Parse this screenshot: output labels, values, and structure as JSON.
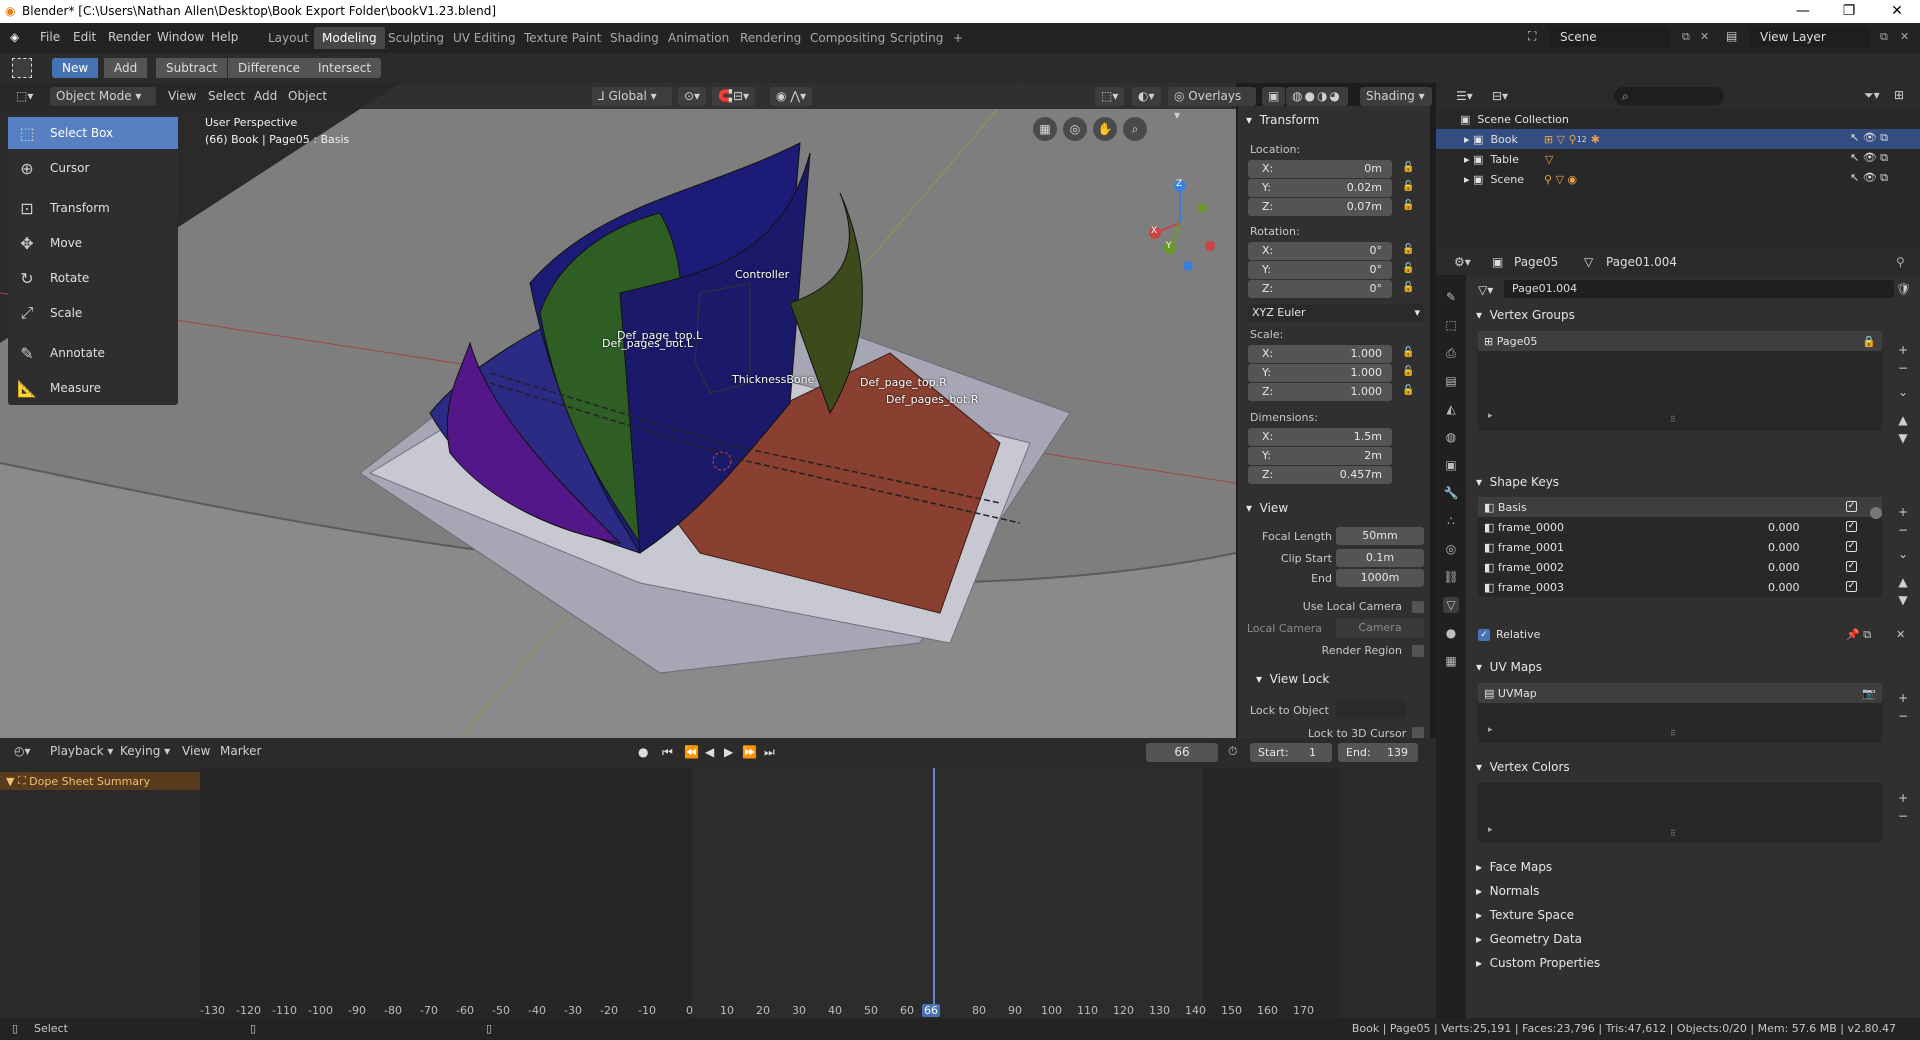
{
  "window": {
    "title": "Blender* [C:\\Users\\Nathan Allen\\Desktop\\Book Export Folder\\bookV1.23.blend]",
    "minimize": "—",
    "maximize": "❐",
    "close": "✕"
  },
  "menu": [
    "File",
    "Edit",
    "Render",
    "Window",
    "Help"
  ],
  "workspaces": [
    "Layout",
    "Modeling",
    "Sculpting",
    "UV Editing",
    "Texture Paint",
    "Shading",
    "Animation",
    "Rendering",
    "Compositing",
    "Scripting",
    "+"
  ],
  "scene": {
    "name": "Scene",
    "view_layer": "View Layer"
  },
  "toolheader": {
    "buttons": [
      "New",
      "Add",
      "Subtract",
      "Difference",
      "Intersect"
    ]
  },
  "viewport": {
    "mode": "Object Mode",
    "menus": [
      "View",
      "Select",
      "Add",
      "Object"
    ],
    "orientation": "Global",
    "overlays": "Overlays",
    "shading": "Shading",
    "perspective": "User Perspective",
    "object_info": "(66) Book | Page05 : Basis"
  },
  "tools": [
    {
      "label": "Select Box",
      "icon": "select-box"
    },
    {
      "label": "Cursor",
      "icon": "cursor"
    },
    {
      "label": "Transform",
      "icon": "transform"
    },
    {
      "label": "Move",
      "icon": "move"
    },
    {
      "label": "Rotate",
      "icon": "rotate"
    },
    {
      "label": "Scale",
      "icon": "scale"
    },
    {
      "label": "Annotate",
      "icon": "annotate"
    },
    {
      "label": "Measure",
      "icon": "measure"
    }
  ],
  "bones": {
    "controller": "Controller",
    "top_l": "Def_page_top.L",
    "bot_l": "Def_pages_bot.L",
    "thickness": "ThicknessBone",
    "top_r": "Def_page_top.R",
    "bot_r": "Def_pages_bot.R"
  },
  "gizmo": {
    "x": "X",
    "y": "Y",
    "z": "Z"
  },
  "npanel": {
    "transform_title": "Transform",
    "location_label": "Location:",
    "location": [
      {
        "k": "X:",
        "v": "0m"
      },
      {
        "k": "Y:",
        "v": "0.02m"
      },
      {
        "k": "Z:",
        "v": "0.07m"
      }
    ],
    "rotation_label": "Rotation:",
    "rotation": [
      {
        "k": "X:",
        "v": "0°"
      },
      {
        "k": "Y:",
        "v": "0°"
      },
      {
        "k": "Z:",
        "v": "0°"
      }
    ],
    "rotation_mode": "XYZ Euler",
    "scale_label": "Scale:",
    "scale": [
      {
        "k": "X:",
        "v": "1.000"
      },
      {
        "k": "Y:",
        "v": "1.000"
      },
      {
        "k": "Z:",
        "v": "1.000"
      }
    ],
    "dimensions_label": "Dimensions:",
    "dimensions": [
      {
        "k": "X:",
        "v": "1.5m"
      },
      {
        "k": "Y:",
        "v": "2m"
      },
      {
        "k": "Z:",
        "v": "0.457m"
      }
    ],
    "view_title": "View",
    "focal_label": "Focal Length",
    "focal": "50mm",
    "clip_start_label": "Clip Start",
    "clip_start": "0.1m",
    "end_label": "End",
    "end": "1000m",
    "use_local_camera": "Use Local Camera",
    "local_camera_label": "Local Camera",
    "local_camera": "Camera",
    "render_region": "Render Region",
    "view_lock": "View Lock",
    "lock_to_object": "Lock to Object",
    "lock_to_cursor": "Lock to 3D Cursor"
  },
  "timeline": {
    "menus": [
      "Playback",
      "Keying",
      "View",
      "Marker"
    ],
    "current": "66",
    "start_label": "Start:",
    "start": "1",
    "end_label": "End:",
    "end": "139",
    "summary": "Dope Sheet Summary",
    "ticks": [
      "-130",
      "-120",
      "-110",
      "-100",
      "-90",
      "-80",
      "-70",
      "-60",
      "-50",
      "-40",
      "-30",
      "-20",
      "-10",
      "0",
      "10",
      "20",
      "30",
      "40",
      "50",
      "60",
      "66",
      "80",
      "90",
      "100",
      "110",
      "120",
      "130",
      "140",
      "150",
      "160",
      "170"
    ]
  },
  "status": {
    "left": "Select",
    "right": "Book | Page05 | Verts:25,191 | Faces:23,796 | Tris:47,612 | Objects:0/20 | Mem: 57.6 MB | v2.80.47"
  },
  "outliner": {
    "root": "Scene Collection",
    "items": [
      "Book",
      "Table",
      "Scene"
    ],
    "book_badge": "12"
  },
  "properties": {
    "object": "Page05",
    "data": "Page01.004",
    "mesh_name": "Page01.004",
    "vertex_groups": "Vertex Groups",
    "vgroup_items": [
      "Page05"
    ],
    "shape_keys": "Shape Keys",
    "keys": [
      {
        "name": "Basis",
        "value": ""
      },
      {
        "name": "frame_0000",
        "value": "0.000"
      },
      {
        "name": "frame_0001",
        "value": "0.000"
      },
      {
        "name": "frame_0002",
        "value": "0.000"
      },
      {
        "name": "frame_0003",
        "value": "0.000"
      }
    ],
    "relative": "Relative",
    "uv_maps": "UV Maps",
    "uv_items": [
      "UVMap"
    ],
    "vertex_colors": "Vertex Colors",
    "collapsed": [
      "Face Maps",
      "Normals",
      "Texture Space",
      "Geometry Data",
      "Custom Properties"
    ]
  }
}
